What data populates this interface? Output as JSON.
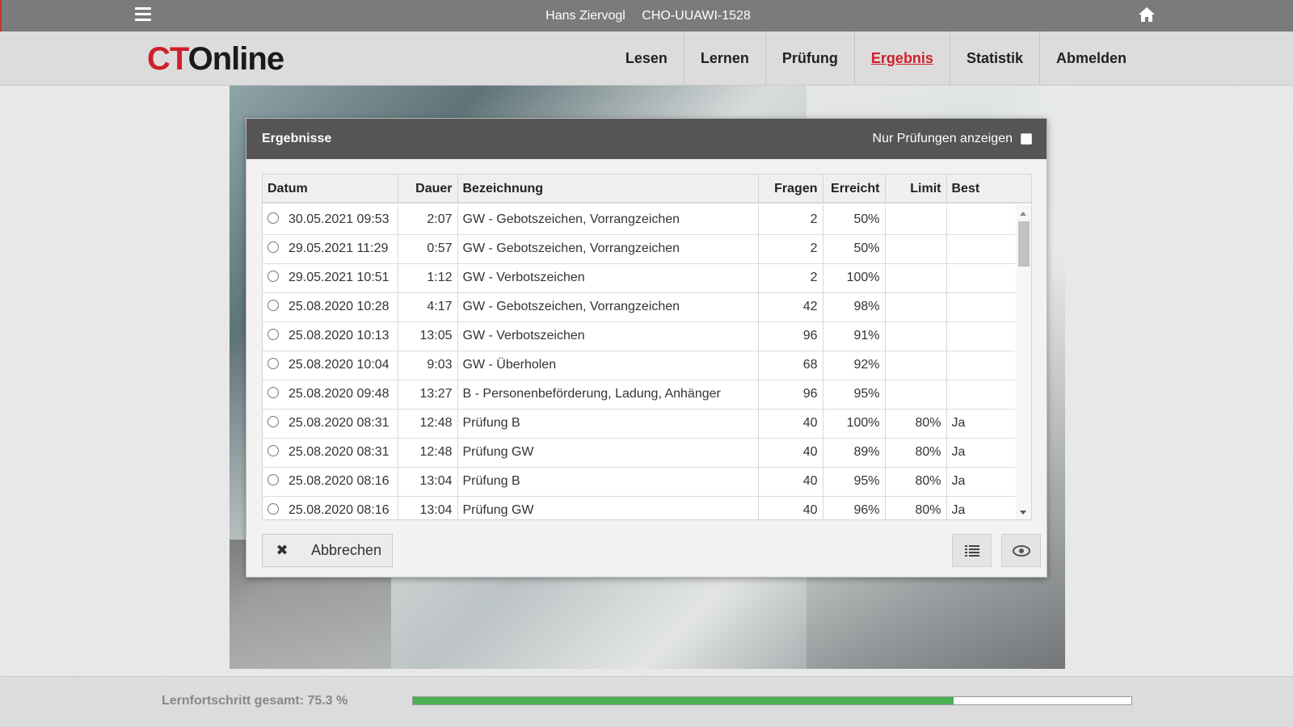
{
  "topbar": {
    "user_name": "Hans Ziervogl",
    "user_code": "CHO-UUAWI-1528"
  },
  "logo": {
    "part1": "CT",
    "part2": "Online"
  },
  "nav": [
    {
      "label": "Lesen",
      "active": false
    },
    {
      "label": "Lernen",
      "active": false
    },
    {
      "label": "Prüfung",
      "active": false
    },
    {
      "label": "Ergebnis",
      "active": true
    },
    {
      "label": "Statistik",
      "active": false
    },
    {
      "label": "Abmelden",
      "active": false
    }
  ],
  "dialog": {
    "title": "Ergebnisse",
    "filter_label": "Nur Prüfungen anzeigen",
    "filter_checked": false,
    "columns": [
      "Datum",
      "Dauer",
      "Bezeichnung",
      "Fragen",
      "Erreicht",
      "Limit",
      "Best"
    ],
    "rows": [
      {
        "datum": "30.05.2021 09:53",
        "dauer": "2:07",
        "bezeichnung": "GW - Gebotszeichen, Vorrangzeichen",
        "fragen": "2",
        "erreicht": "50%",
        "limit": "",
        "best": ""
      },
      {
        "datum": "29.05.2021 11:29",
        "dauer": "0:57",
        "bezeichnung": "GW - Gebotszeichen, Vorrangzeichen",
        "fragen": "2",
        "erreicht": "50%",
        "limit": "",
        "best": ""
      },
      {
        "datum": "29.05.2021 10:51",
        "dauer": "1:12",
        "bezeichnung": "GW - Verbotszeichen",
        "fragen": "2",
        "erreicht": "100%",
        "limit": "",
        "best": ""
      },
      {
        "datum": "25.08.2020 10:28",
        "dauer": "4:17",
        "bezeichnung": "GW - Gebotszeichen, Vorrangzeichen",
        "fragen": "42",
        "erreicht": "98%",
        "limit": "",
        "best": ""
      },
      {
        "datum": "25.08.2020 10:13",
        "dauer": "13:05",
        "bezeichnung": "GW - Verbotszeichen",
        "fragen": "96",
        "erreicht": "91%",
        "limit": "",
        "best": ""
      },
      {
        "datum": "25.08.2020 10:04",
        "dauer": "9:03",
        "bezeichnung": "GW - Überholen",
        "fragen": "68",
        "erreicht": "92%",
        "limit": "",
        "best": ""
      },
      {
        "datum": "25.08.2020 09:48",
        "dauer": "13:27",
        "bezeichnung": "B - Personenbeförderung, Ladung, Anhänger",
        "fragen": "96",
        "erreicht": "95%",
        "limit": "",
        "best": ""
      },
      {
        "datum": "25.08.2020 08:31",
        "dauer": "12:48",
        "bezeichnung": "Prüfung B",
        "fragen": "40",
        "erreicht": "100%",
        "limit": "80%",
        "best": "Ja"
      },
      {
        "datum": "25.08.2020 08:31",
        "dauer": "12:48",
        "bezeichnung": "Prüfung GW",
        "fragen": "40",
        "erreicht": "89%",
        "limit": "80%",
        "best": "Ja"
      },
      {
        "datum": "25.08.2020 08:16",
        "dauer": "13:04",
        "bezeichnung": "Prüfung B",
        "fragen": "40",
        "erreicht": "95%",
        "limit": "80%",
        "best": "Ja"
      },
      {
        "datum": "25.08.2020 08:16",
        "dauer": "13:04",
        "bezeichnung": "Prüfung GW",
        "fragen": "40",
        "erreicht": "96%",
        "limit": "80%",
        "best": "Ja"
      }
    ],
    "cancel_label": "Abbrechen",
    "icons": {
      "cancel": "close-icon",
      "list": "list-icon",
      "view": "eye-icon"
    }
  },
  "footer": {
    "progress_label": "Lernfortschritt gesamt: 75.3 %",
    "progress_value": 75.3
  },
  "colors": {
    "brand_red": "#d01f2a",
    "topbar": "#7b7b7b",
    "dialog_header": "#555555",
    "progress": "#4caf50"
  }
}
